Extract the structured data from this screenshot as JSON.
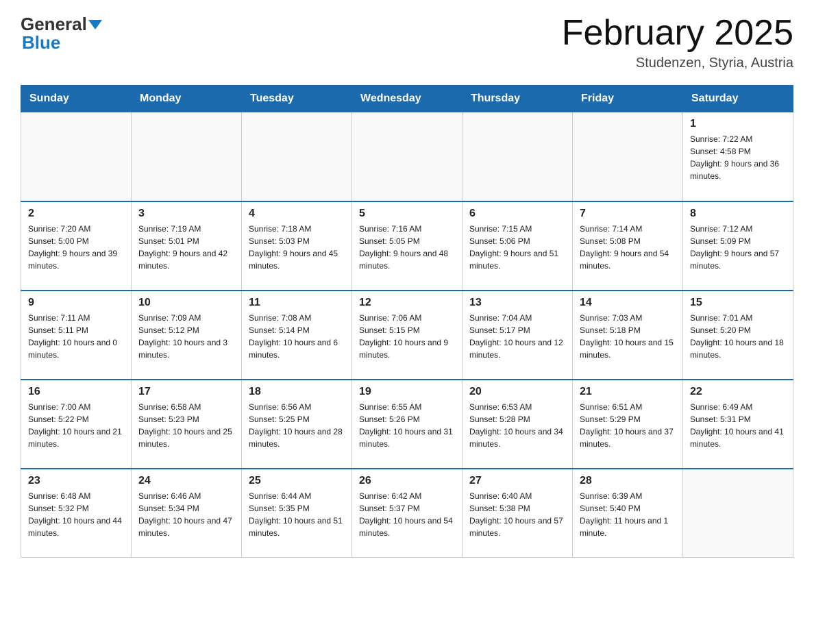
{
  "header": {
    "logo_general": "General",
    "logo_blue": "Blue",
    "title": "February 2025",
    "subtitle": "Studenzen, Styria, Austria"
  },
  "days_of_week": [
    "Sunday",
    "Monday",
    "Tuesday",
    "Wednesday",
    "Thursday",
    "Friday",
    "Saturday"
  ],
  "weeks": [
    {
      "days": [
        {
          "number": "",
          "info": ""
        },
        {
          "number": "",
          "info": ""
        },
        {
          "number": "",
          "info": ""
        },
        {
          "number": "",
          "info": ""
        },
        {
          "number": "",
          "info": ""
        },
        {
          "number": "",
          "info": ""
        },
        {
          "number": "1",
          "info": "Sunrise: 7:22 AM\nSunset: 4:58 PM\nDaylight: 9 hours and 36 minutes."
        }
      ]
    },
    {
      "days": [
        {
          "number": "2",
          "info": "Sunrise: 7:20 AM\nSunset: 5:00 PM\nDaylight: 9 hours and 39 minutes."
        },
        {
          "number": "3",
          "info": "Sunrise: 7:19 AM\nSunset: 5:01 PM\nDaylight: 9 hours and 42 minutes."
        },
        {
          "number": "4",
          "info": "Sunrise: 7:18 AM\nSunset: 5:03 PM\nDaylight: 9 hours and 45 minutes."
        },
        {
          "number": "5",
          "info": "Sunrise: 7:16 AM\nSunset: 5:05 PM\nDaylight: 9 hours and 48 minutes."
        },
        {
          "number": "6",
          "info": "Sunrise: 7:15 AM\nSunset: 5:06 PM\nDaylight: 9 hours and 51 minutes."
        },
        {
          "number": "7",
          "info": "Sunrise: 7:14 AM\nSunset: 5:08 PM\nDaylight: 9 hours and 54 minutes."
        },
        {
          "number": "8",
          "info": "Sunrise: 7:12 AM\nSunset: 5:09 PM\nDaylight: 9 hours and 57 minutes."
        }
      ]
    },
    {
      "days": [
        {
          "number": "9",
          "info": "Sunrise: 7:11 AM\nSunset: 5:11 PM\nDaylight: 10 hours and 0 minutes."
        },
        {
          "number": "10",
          "info": "Sunrise: 7:09 AM\nSunset: 5:12 PM\nDaylight: 10 hours and 3 minutes."
        },
        {
          "number": "11",
          "info": "Sunrise: 7:08 AM\nSunset: 5:14 PM\nDaylight: 10 hours and 6 minutes."
        },
        {
          "number": "12",
          "info": "Sunrise: 7:06 AM\nSunset: 5:15 PM\nDaylight: 10 hours and 9 minutes."
        },
        {
          "number": "13",
          "info": "Sunrise: 7:04 AM\nSunset: 5:17 PM\nDaylight: 10 hours and 12 minutes."
        },
        {
          "number": "14",
          "info": "Sunrise: 7:03 AM\nSunset: 5:18 PM\nDaylight: 10 hours and 15 minutes."
        },
        {
          "number": "15",
          "info": "Sunrise: 7:01 AM\nSunset: 5:20 PM\nDaylight: 10 hours and 18 minutes."
        }
      ]
    },
    {
      "days": [
        {
          "number": "16",
          "info": "Sunrise: 7:00 AM\nSunset: 5:22 PM\nDaylight: 10 hours and 21 minutes."
        },
        {
          "number": "17",
          "info": "Sunrise: 6:58 AM\nSunset: 5:23 PM\nDaylight: 10 hours and 25 minutes."
        },
        {
          "number": "18",
          "info": "Sunrise: 6:56 AM\nSunset: 5:25 PM\nDaylight: 10 hours and 28 minutes."
        },
        {
          "number": "19",
          "info": "Sunrise: 6:55 AM\nSunset: 5:26 PM\nDaylight: 10 hours and 31 minutes."
        },
        {
          "number": "20",
          "info": "Sunrise: 6:53 AM\nSunset: 5:28 PM\nDaylight: 10 hours and 34 minutes."
        },
        {
          "number": "21",
          "info": "Sunrise: 6:51 AM\nSunset: 5:29 PM\nDaylight: 10 hours and 37 minutes."
        },
        {
          "number": "22",
          "info": "Sunrise: 6:49 AM\nSunset: 5:31 PM\nDaylight: 10 hours and 41 minutes."
        }
      ]
    },
    {
      "days": [
        {
          "number": "23",
          "info": "Sunrise: 6:48 AM\nSunset: 5:32 PM\nDaylight: 10 hours and 44 minutes."
        },
        {
          "number": "24",
          "info": "Sunrise: 6:46 AM\nSunset: 5:34 PM\nDaylight: 10 hours and 47 minutes."
        },
        {
          "number": "25",
          "info": "Sunrise: 6:44 AM\nSunset: 5:35 PM\nDaylight: 10 hours and 51 minutes."
        },
        {
          "number": "26",
          "info": "Sunrise: 6:42 AM\nSunset: 5:37 PM\nDaylight: 10 hours and 54 minutes."
        },
        {
          "number": "27",
          "info": "Sunrise: 6:40 AM\nSunset: 5:38 PM\nDaylight: 10 hours and 57 minutes."
        },
        {
          "number": "28",
          "info": "Sunrise: 6:39 AM\nSunset: 5:40 PM\nDaylight: 11 hours and 1 minute."
        },
        {
          "number": "",
          "info": ""
        }
      ]
    }
  ]
}
